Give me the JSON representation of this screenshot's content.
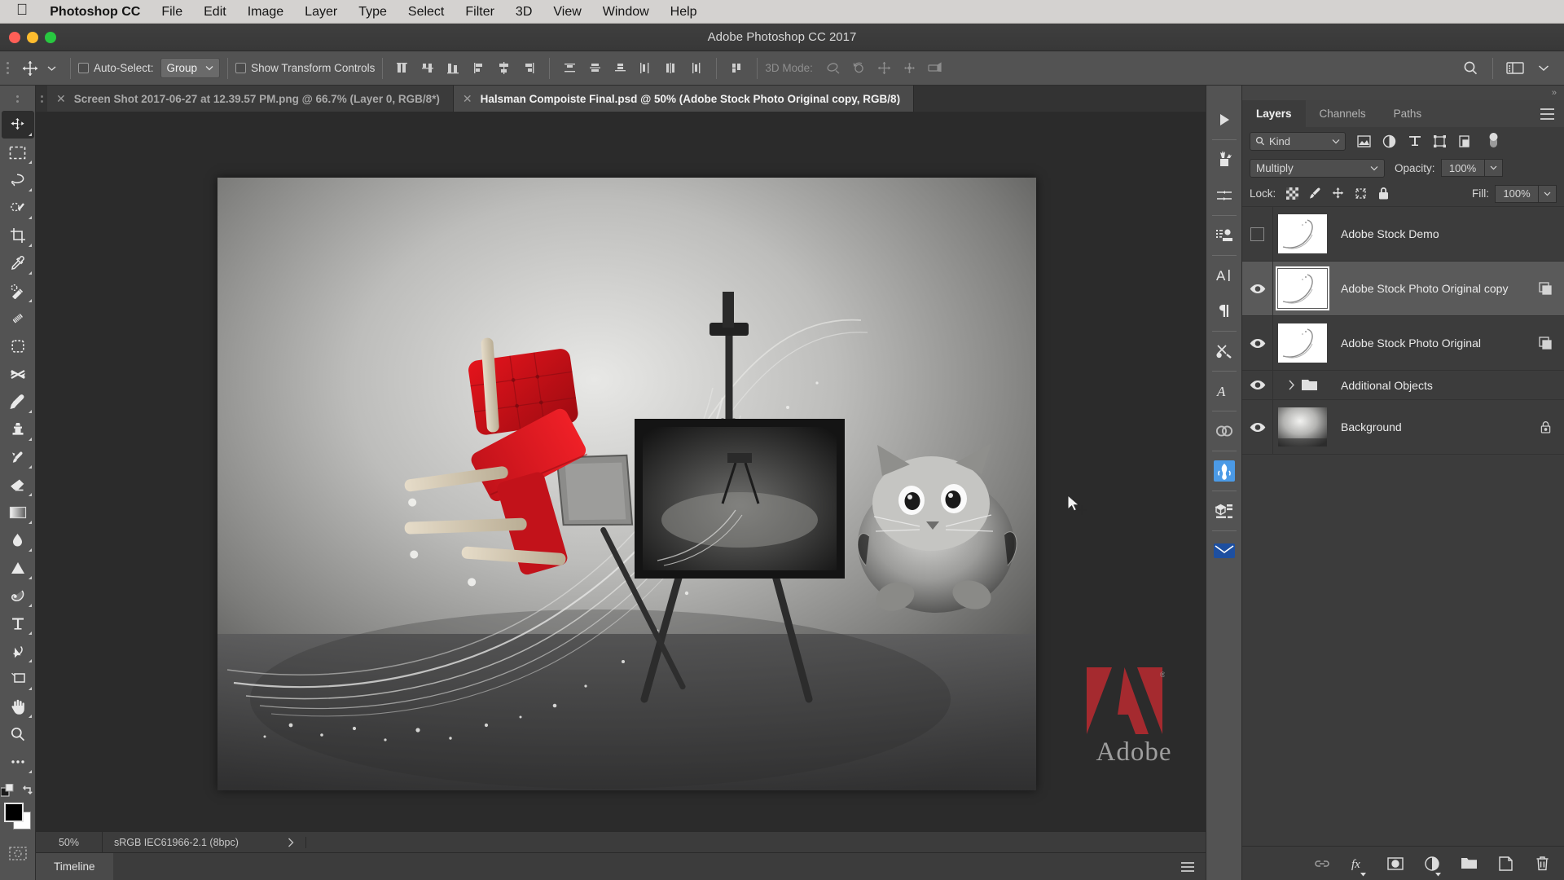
{
  "menubar": {
    "apple_icon": "apple-logo-icon",
    "app_name": "Photoshop CC",
    "items": [
      "File",
      "Edit",
      "Image",
      "Layer",
      "Type",
      "Select",
      "Filter",
      "3D",
      "View",
      "Window",
      "Help"
    ]
  },
  "titlebar": {
    "title": "Adobe Photoshop CC 2017",
    "close_color": "#ff5f57",
    "minimize_color": "#febc2e",
    "zoom_color": "#28c840"
  },
  "options_bar": {
    "tool_icon": "move-tool-icon",
    "auto_select_label": "Auto-Select:",
    "auto_select_checked": false,
    "group_value": "Group",
    "show_transform_label": "Show Transform Controls",
    "show_transform_checked": false,
    "align_icons": [
      "align-left-edges-icon",
      "align-horizontal-centers-icon",
      "align-right-edges-icon",
      "align-top-edges-icon",
      "align-vertical-centers-icon",
      "align-bottom-edges-icon"
    ],
    "distribute_icons": [
      "distribute-top-edges-icon",
      "distribute-vertical-centers-icon",
      "distribute-bottom-edges-icon",
      "distribute-left-edges-icon",
      "distribute-horizontal-centers-icon",
      "distribute-right-edges-icon"
    ],
    "more_align_icon": "align-more-options-icon",
    "mode_3d_label": "3D Mode:",
    "mode_3d_icons": [
      "orbit-3d-icon",
      "roll-3d-icon",
      "pan-3d-icon",
      "slide-3d-icon",
      "scale-3d-icon"
    ],
    "search_icon": "search-icon",
    "workspace_icon": "workspace-switcher-icon",
    "workspace_chevron_icon": "chevron-down-icon"
  },
  "tabs": [
    {
      "label": "Screen Shot 2017-06-27 at 12.39.57 PM.png @ 66.7% (Layer 0, RGB/8*)",
      "active": false,
      "close_icon": "close-icon"
    },
    {
      "label": "Halsman Compoiste Final.psd @ 50% (Adobe Stock Photo Original copy, RGB/8)",
      "active": true,
      "close_icon": "close-icon"
    }
  ],
  "toolbar": {
    "tools": [
      {
        "name": "move-tool",
        "selected": true,
        "has_flyout": true
      },
      {
        "name": "rectangular-marquee-tool",
        "selected": false,
        "has_flyout": true
      },
      {
        "name": "lasso-tool",
        "selected": false,
        "has_flyout": true
      },
      {
        "name": "quick-selection-tool",
        "selected": false,
        "has_flyout": true
      },
      {
        "name": "crop-tool",
        "selected": false,
        "has_flyout": true
      },
      {
        "name": "eyedropper-tool",
        "selected": false,
        "has_flyout": true
      },
      {
        "name": "spot-healing-brush-tool",
        "selected": false,
        "has_flyout": true
      },
      {
        "name": "healing-brush-tool",
        "selected": false,
        "has_flyout": false
      },
      {
        "name": "patch-tool",
        "selected": false,
        "has_flyout": false
      },
      {
        "name": "content-aware-move-tool",
        "selected": false,
        "has_flyout": false
      },
      {
        "name": "brush-tool",
        "selected": false,
        "has_flyout": true
      },
      {
        "name": "clone-stamp-tool",
        "selected": false,
        "has_flyout": true
      },
      {
        "name": "history-brush-tool",
        "selected": false,
        "has_flyout": true
      },
      {
        "name": "eraser-tool",
        "selected": false,
        "has_flyout": true
      },
      {
        "name": "gradient-tool",
        "selected": false,
        "has_flyout": true
      },
      {
        "name": "blur-tool",
        "selected": false,
        "has_flyout": true
      },
      {
        "name": "dodge-tool",
        "selected": false,
        "has_flyout": true
      },
      {
        "name": "pen-tool",
        "selected": false,
        "has_flyout": true
      },
      {
        "name": "horizontal-type-tool",
        "selected": false,
        "has_flyout": true
      },
      {
        "name": "path-selection-tool",
        "selected": false,
        "has_flyout": true
      },
      {
        "name": "rectangle-shape-tool",
        "selected": false,
        "has_flyout": true
      },
      {
        "name": "hand-tool",
        "selected": false,
        "has_flyout": true
      },
      {
        "name": "zoom-tool",
        "selected": false,
        "has_flyout": false
      },
      {
        "name": "edit-toolbar-tool",
        "selected": false,
        "has_flyout": true
      }
    ],
    "foreground_color": "#000000",
    "background_color": "#ffffff",
    "swap_colors_icon": "swap-colors-icon",
    "default_colors_icon": "default-colors-icon",
    "quick_mask_icon": "quick-mask-mode-icon"
  },
  "canvas": {
    "zoom": "50%",
    "artwork_description": "Halsman composite: flying red chair, easel with framed photo, water splash, leaping cat on grey studio wall"
  },
  "statusbar": {
    "zoom": "50%",
    "color_profile": "sRGB IEC61966-2.1 (8bpc)",
    "profile_chevron_icon": "chevron-right-icon",
    "timeline_tab": "Timeline",
    "timeline_menu_icon": "panel-menu-icon"
  },
  "icon_rail": [
    {
      "name": "expand-panels-icon"
    },
    {
      "name": "brush-presets-icon"
    },
    {
      "name": "brush-settings-icon"
    },
    {
      "name": "clone-source-icon"
    },
    {
      "name": "character-panel-icon"
    },
    {
      "name": "paragraph-panel-icon"
    },
    {
      "name": "tool-presets-icon"
    },
    {
      "name": "glyphs-panel-icon"
    },
    {
      "name": "creative-cloud-libraries-icon"
    },
    {
      "name": "adobe-stock-icon"
    },
    {
      "name": "3d-panel-icon"
    },
    {
      "name": "measurement-log-icon"
    }
  ],
  "panel": {
    "collapse_icon": "collapse-to-icons-icon",
    "tabs": [
      {
        "label": "Layers",
        "active": true
      },
      {
        "label": "Channels",
        "active": false
      },
      {
        "label": "Paths",
        "active": false
      }
    ],
    "menu_icon": "panel-menu-icon",
    "filter": {
      "search_icon": "search-icon",
      "kind_label": "Kind",
      "chevron_icon": "chevron-down-icon",
      "type_filters": [
        "filter-pixel-layers-icon",
        "filter-adjustment-layers-icon",
        "filter-type-layers-icon",
        "filter-shape-layers-icon",
        "filter-smart-objects-icon"
      ],
      "toggle_icon": "filter-toggle-icon"
    },
    "blend_mode": "Multiply",
    "blend_chevron_icon": "chevron-down-icon",
    "opacity_label": "Opacity:",
    "opacity_value": "100%",
    "opacity_chevron_icon": "chevron-down-icon",
    "lock_label": "Lock:",
    "lock_icons": [
      "lock-transparent-pixels-icon",
      "lock-image-pixels-icon",
      "lock-position-icon",
      "lock-artboard-nesting-icon",
      "lock-all-icon"
    ],
    "fill_label": "Fill:",
    "fill_value": "100%",
    "fill_chevron_icon": "chevron-down-icon",
    "layers": [
      {
        "name": "Adobe Stock Demo",
        "visible": false,
        "selected": false,
        "type": "smart-object",
        "badge_icon": "smart-object-badge-icon",
        "thumb": "splash"
      },
      {
        "name": "Adobe Stock Photo Original copy",
        "visible": true,
        "selected": true,
        "type": "smart-object",
        "badge_icon": "smart-object-badge-icon",
        "thumb": "splash"
      },
      {
        "name": "Adobe Stock Photo Original",
        "visible": true,
        "selected": false,
        "type": "smart-object",
        "badge_icon": "smart-object-badge-icon",
        "thumb": "splash"
      },
      {
        "name": "Additional Objects",
        "visible": true,
        "selected": false,
        "type": "group",
        "badge_icon": "",
        "thumb": "folder",
        "expand_icon": "chevron-right-icon"
      },
      {
        "name": "Background",
        "visible": true,
        "selected": false,
        "type": "background",
        "badge_icon": "lock-icon",
        "thumb": "background"
      }
    ],
    "bottom_buttons": [
      {
        "name": "link-layers-button",
        "icon": "link-icon"
      },
      {
        "name": "layer-style-button",
        "icon": "fx-icon"
      },
      {
        "name": "add-layer-mask-button",
        "icon": "layer-mask-icon"
      },
      {
        "name": "new-adjustment-layer-button",
        "icon": "adjustment-layer-icon"
      },
      {
        "name": "new-group-button",
        "icon": "folder-icon"
      },
      {
        "name": "new-layer-button",
        "icon": "new-layer-icon"
      },
      {
        "name": "delete-layer-button",
        "icon": "trash-icon"
      }
    ]
  },
  "watermark": {
    "brand": "Adobe",
    "logo_color": "#b02a30",
    "registered_mark": "®"
  }
}
